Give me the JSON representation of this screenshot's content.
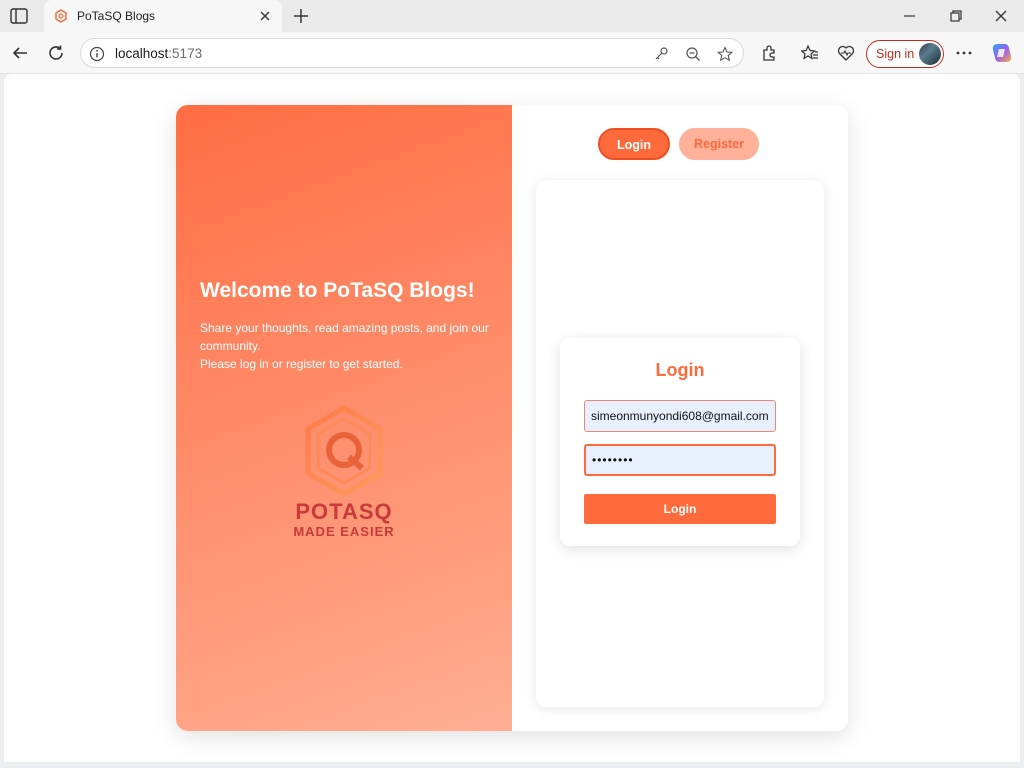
{
  "browser": {
    "tab": {
      "title": "PoTaSQ Blogs",
      "favicon": "potasq-favicon-icon"
    },
    "url": {
      "host": "localhost",
      "port": ":5173"
    },
    "signin_label": "Sign in"
  },
  "hero": {
    "title": "Welcome to PoTaSQ Blogs!",
    "text_line1": "Share your thoughts, read amazing posts, and join our community.",
    "text_line2": "Please log in or register to get started.",
    "logo_wordmark": "POTASQ",
    "logo_tagline": "MADE EASIER"
  },
  "toggle": {
    "login_label": "Login",
    "register_label": "Register"
  },
  "login_form": {
    "heading": "Login",
    "email_value": "simeonmunyondi608@gmail.com",
    "password_value": "••••••••",
    "submit_label": "Login"
  },
  "colors": {
    "accent": "#ff6a3d",
    "accent_light": "#ffb19a",
    "logo_red": "#c93a3a"
  }
}
